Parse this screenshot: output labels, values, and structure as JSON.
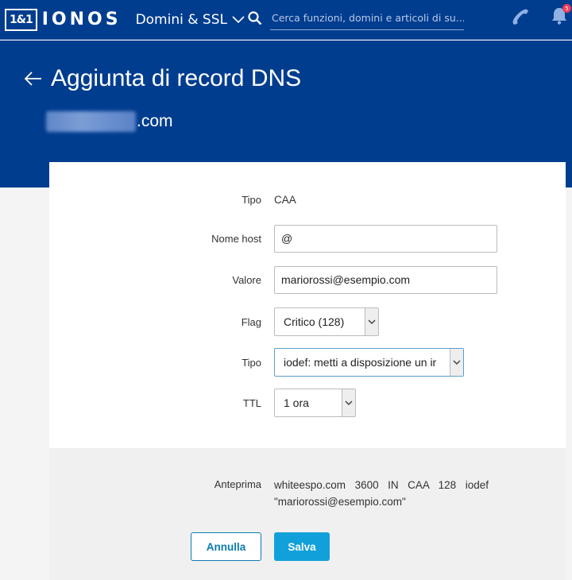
{
  "nav": {
    "logo_box": "1&1",
    "logo_text": "IONOS",
    "menu_label": "Domini & SSL",
    "search_placeholder": "Cerca funzioni, domini e articoli di su...",
    "notification_count": "5"
  },
  "header": {
    "title": "Aggiunta di record DNS",
    "domain_suffix": ".com"
  },
  "form": {
    "type_label": "Tipo",
    "type_value": "CAA",
    "host_label": "Nome host",
    "host_value": "@",
    "value_label": "Valore",
    "value_value": "mariorossi@esempio.com",
    "flag_label": "Flag",
    "flag_value": "Critico (128)",
    "tag_label": "Tipo",
    "tag_value": "iodef: metti a disposizione un ir",
    "ttl_label": "TTL",
    "ttl_value": "1 ora"
  },
  "preview": {
    "label": "Anteprima",
    "text": "whiteespo.com 3600 IN CAA 128 iodef \"mariorossi@esempio.com\""
  },
  "buttons": {
    "cancel": "Annulla",
    "save": "Salva"
  },
  "colors": {
    "brand_blue": "#003d8f",
    "primary_button": "#11a0d9",
    "secondary_button_border": "#0b7bb0"
  }
}
